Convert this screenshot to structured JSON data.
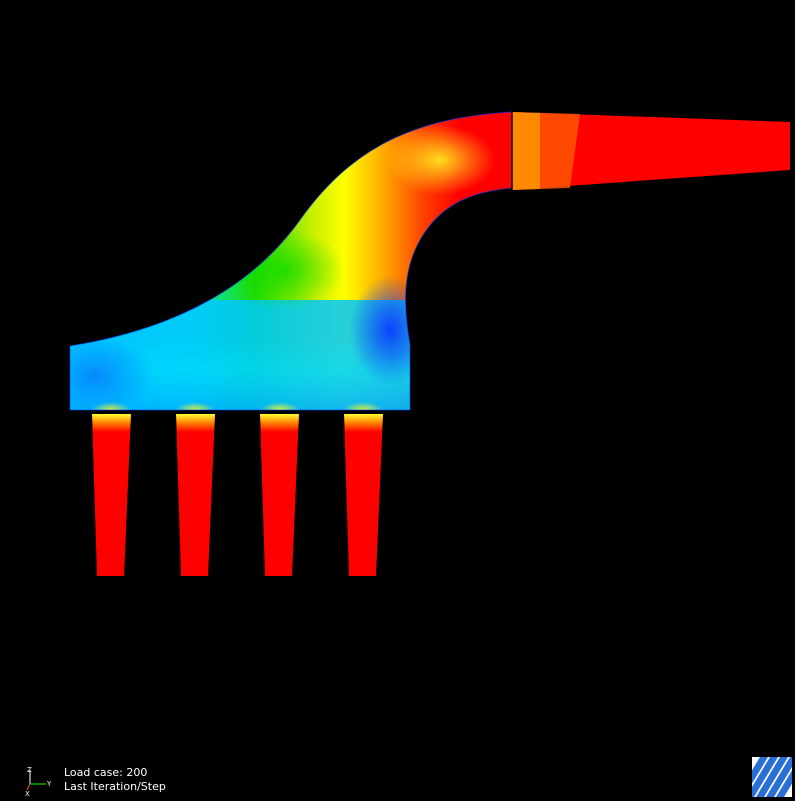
{
  "status": {
    "load_case": "Load case: 200",
    "step": "Last Iteration/Step"
  },
  "triad": {
    "axis_z": "Z",
    "axis_y": "Y",
    "axis_x": "X"
  },
  "colors": {
    "background": "#000000",
    "low": "#0a3cff",
    "mid_low": "#00e5ff",
    "mid": "#00e000",
    "mid_high": "#ffff00",
    "high": "#ff0000",
    "logo": "#2a6fd6"
  },
  "icons": [
    "coordinate-triad-icon",
    "vendor-logo-icon"
  ]
}
